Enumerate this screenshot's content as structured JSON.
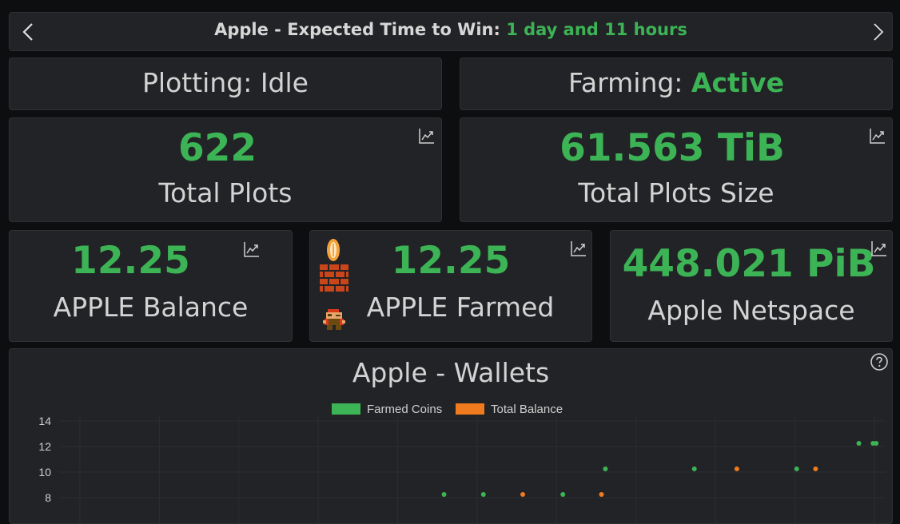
{
  "header": {
    "title_prefix": "Apple - Expected Time to Win: ",
    "time_to_win": "1 day and 11 hours"
  },
  "status": {
    "plotting_label": "Plotting: ",
    "plotting_value": "Idle",
    "farming_label": "Farming: ",
    "farming_value": "Active"
  },
  "stats": {
    "total_plots_value": "622",
    "total_plots_label": "Total Plots",
    "plots_size_value": "61.563 TiB",
    "plots_size_label": "Total Plots Size",
    "balance_value": "12.25",
    "balance_label": "APPLE Balance",
    "farmed_value": "12.25",
    "farmed_label": "APPLE Farmed",
    "netspace_value": "448.021 PiB",
    "netspace_label": "Apple Netspace"
  },
  "icons": {
    "prev": "chevron-left-icon",
    "next": "chevron-right-icon",
    "chart": "trending-chart-icon",
    "help": "question-circle-icon",
    "decor": "coin-brick-mario-sprite"
  },
  "colors": {
    "accent_green": "#3cb455",
    "series_orange": "#f07a1e",
    "card_bg": "#222326",
    "page_bg": "#0d0e10"
  },
  "chart_data": {
    "type": "scatter",
    "title": "Apple - Wallets",
    "ylabel": "",
    "series": [
      {
        "name": "Farmed Coins",
        "color": "#3cb455",
        "x": [
          0.489,
          0.539,
          0.64,
          0.694,
          0.807,
          0.937,
          1.016,
          1.034,
          1.038
        ],
        "y": [
          8.25,
          8.25,
          8.25,
          10.25,
          10.25,
          10.25,
          12.25,
          12.25,
          12.25
        ]
      },
      {
        "name": "Total Balance",
        "color": "#f07a1e",
        "x": [
          0.589,
          0.689,
          0.861,
          0.961
        ],
        "y": [
          8.25,
          8.25,
          10.25,
          10.25
        ]
      }
    ],
    "ylim": [
      7,
      14.5
    ],
    "yticks": [
      "14",
      "12",
      "10",
      "8"
    ],
    "xlim": [
      0,
      1.05
    ],
    "grid": true,
    "legend": "top-center"
  }
}
